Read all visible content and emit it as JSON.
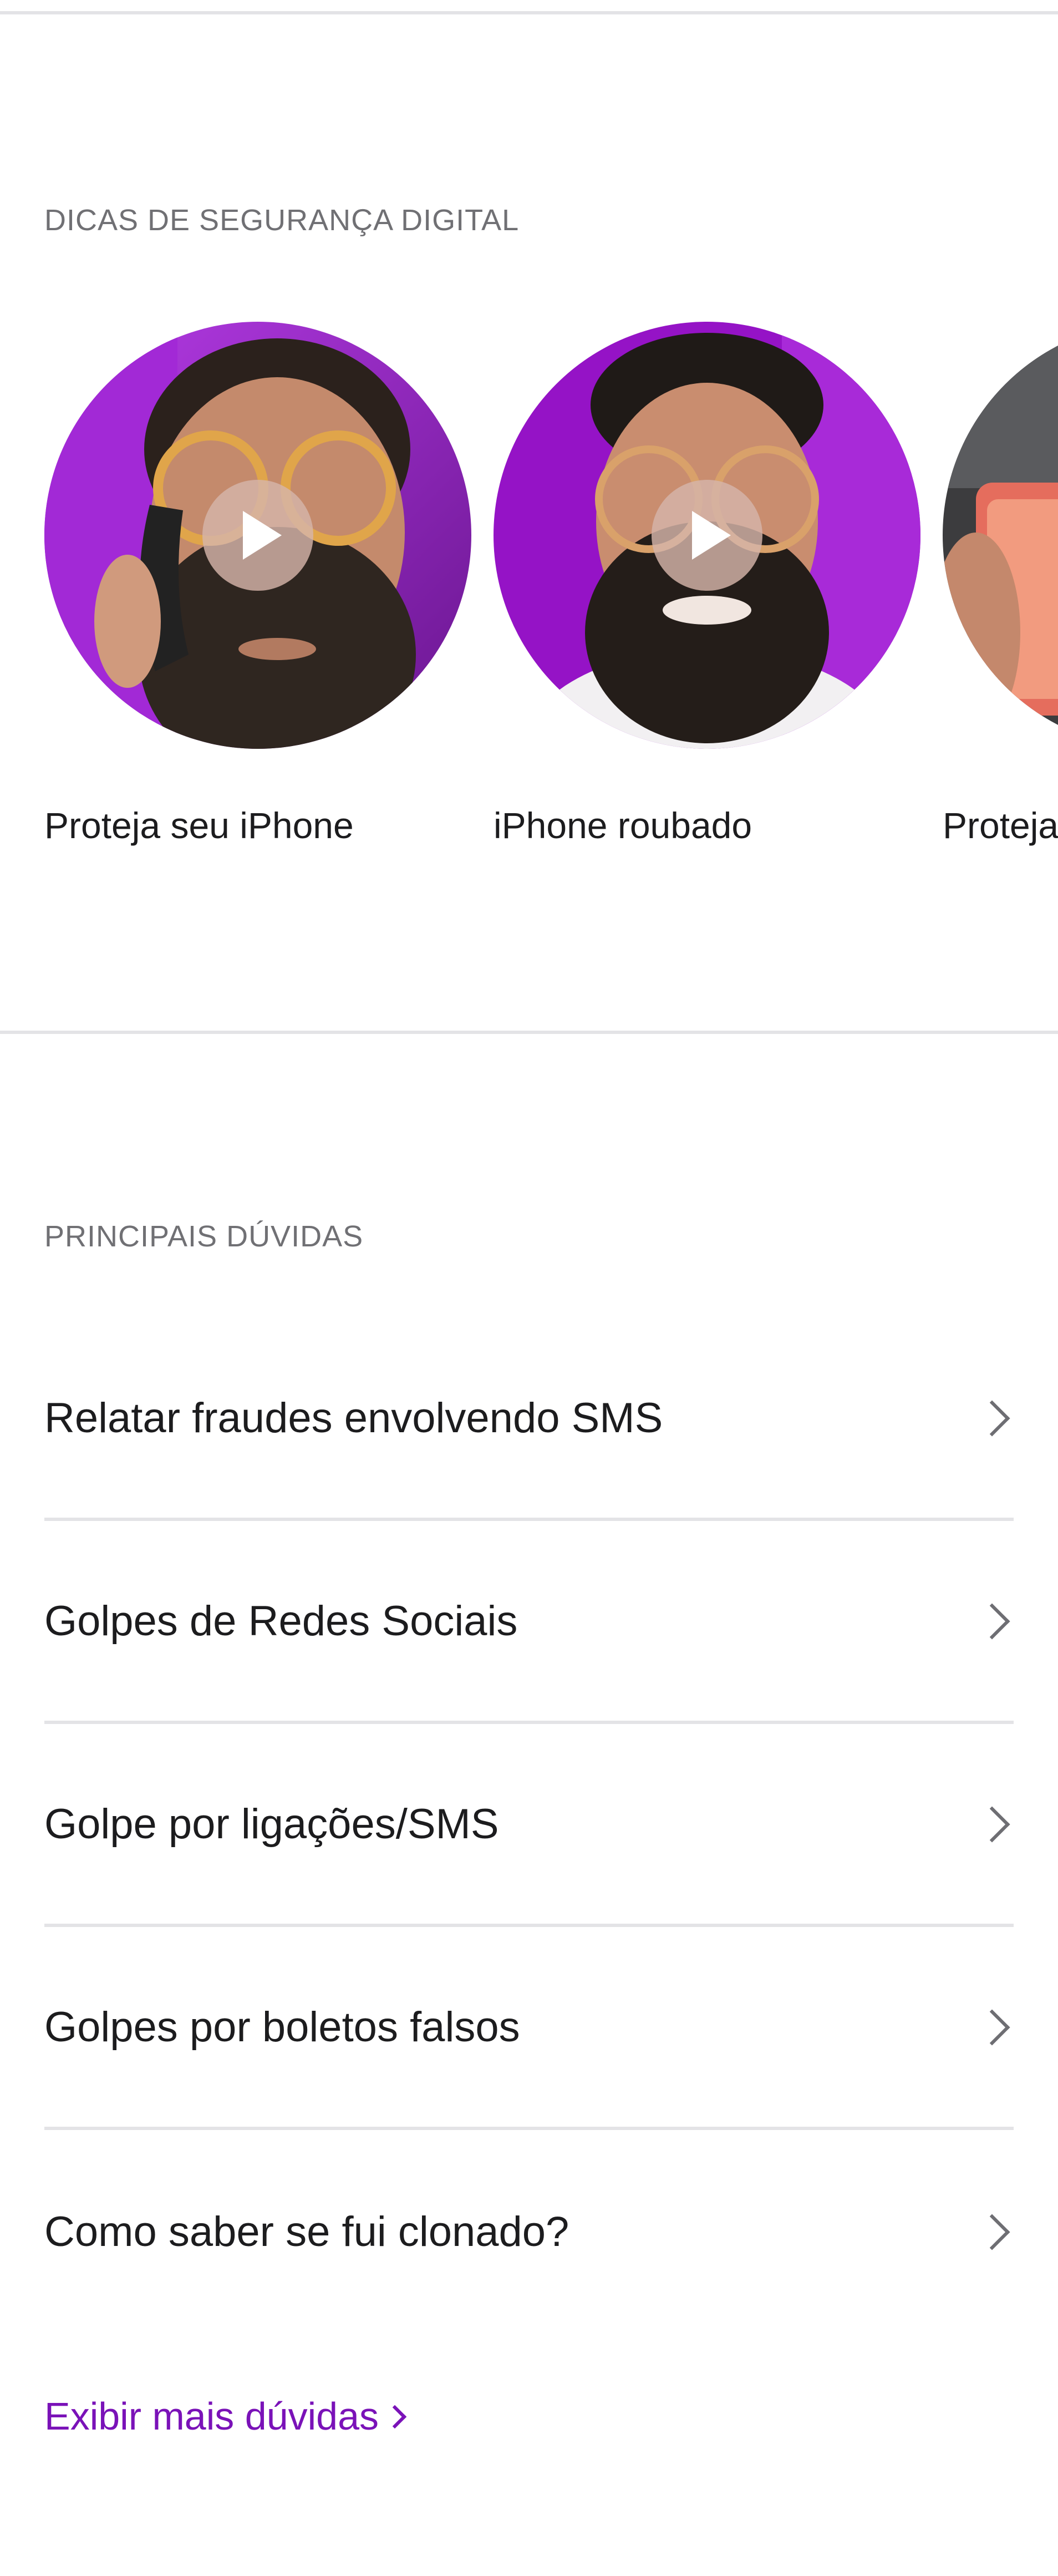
{
  "colors": {
    "accent": "#7a12b8",
    "thumb_purple": "#9b16c8",
    "divider": "#e3e3e6",
    "label_gray": "#707074"
  },
  "tips_section": {
    "title": "DICAS DE SEGURANÇA DIGITAL",
    "videos": [
      {
        "caption": "Proteja seu iPhone",
        "icon": "play-icon"
      },
      {
        "caption": "iPhone roubado",
        "icon": "play-icon"
      },
      {
        "caption": "Proteja",
        "icon": "play-icon"
      }
    ]
  },
  "faq_section": {
    "title": "PRINCIPAIS DÚVIDAS",
    "items": [
      {
        "label": "Relatar fraudes envolvendo SMS",
        "icon": "chevron-right-icon"
      },
      {
        "label": "Golpes de Redes Sociais",
        "icon": "chevron-right-icon"
      },
      {
        "label": "Golpe por ligações/SMS",
        "icon": "chevron-right-icon"
      },
      {
        "label": "Golpes por boletos falsos",
        "icon": "chevron-right-icon"
      },
      {
        "label": "Como saber se fui clonado?",
        "icon": "chevron-right-icon"
      }
    ],
    "more_link": "Exibir mais dúvidas"
  }
}
